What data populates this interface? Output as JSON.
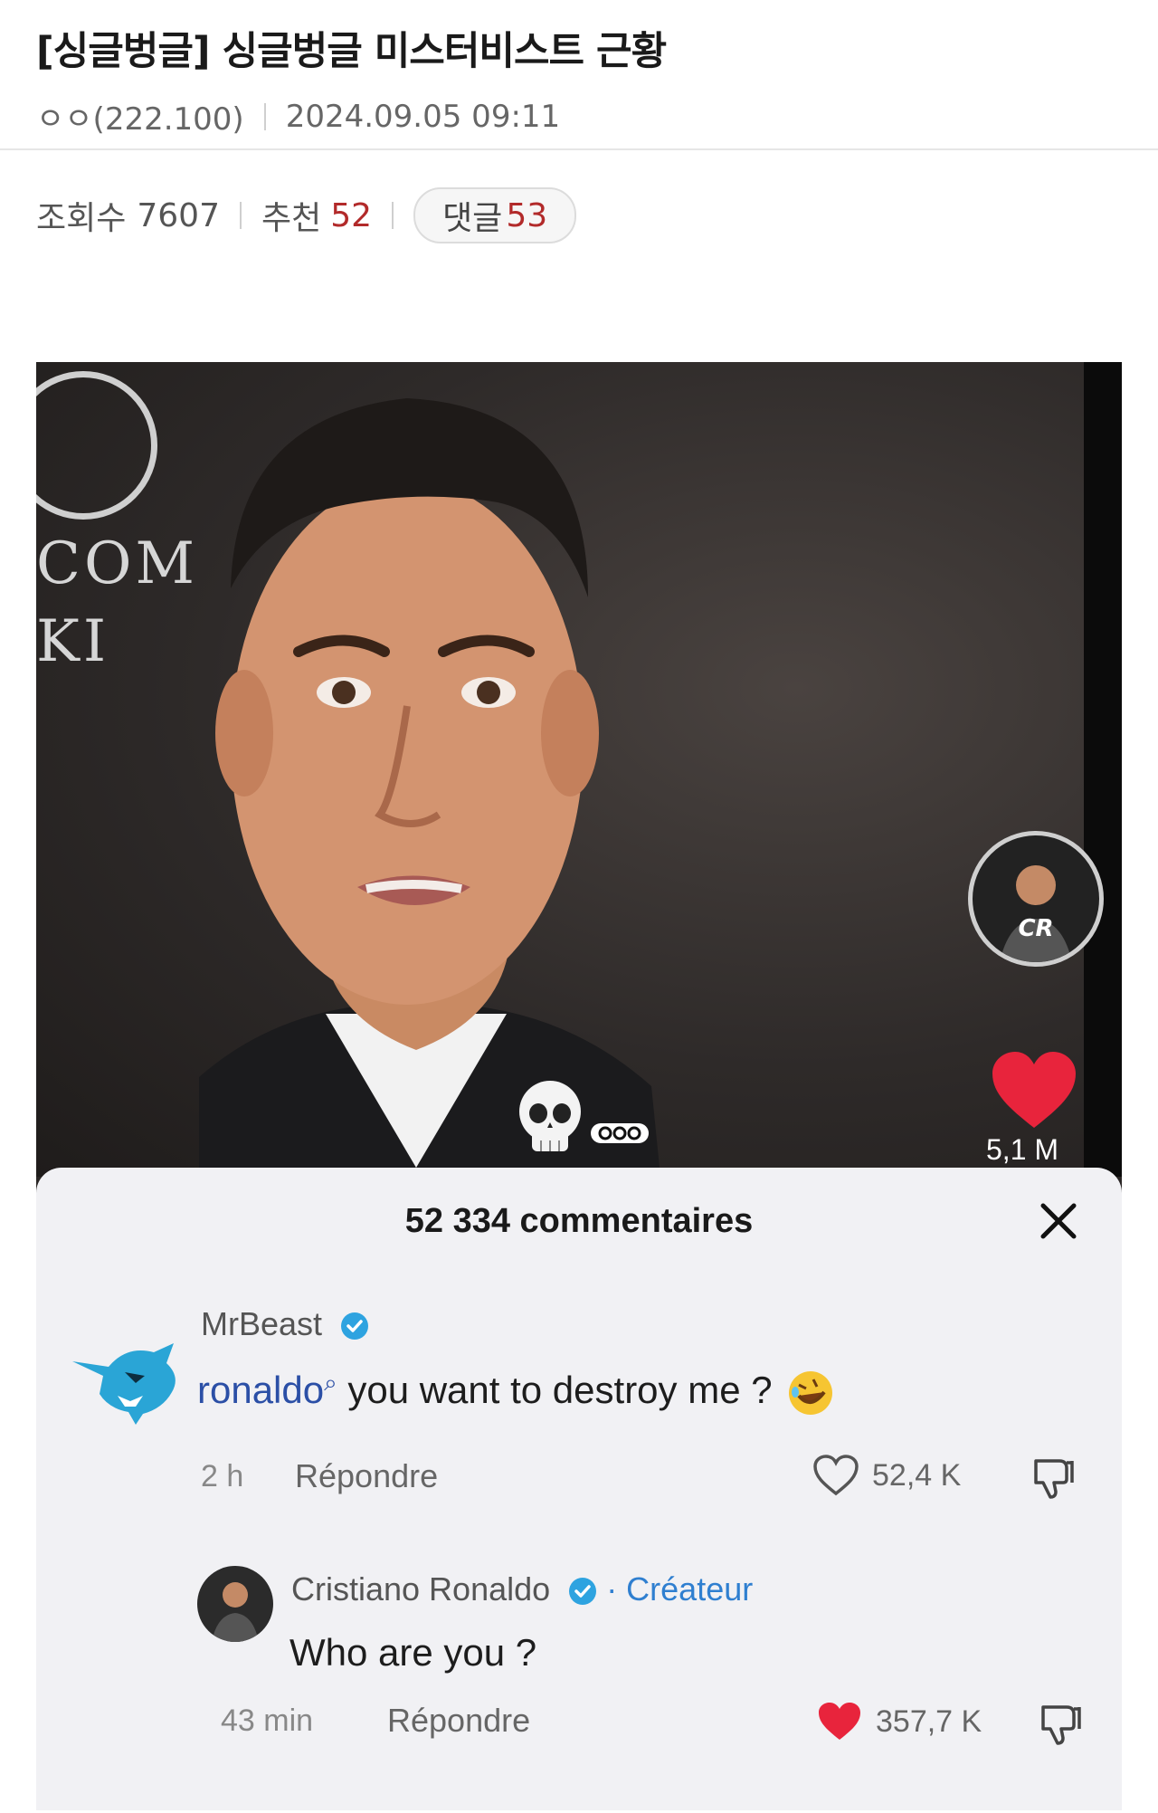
{
  "post": {
    "title": "[싱글벙글] 싱글벙글 미스터비스트 근황",
    "author": "ㅇㅇ(222.100)",
    "datetime": "2024.09.05 09:11",
    "views_label": "조회수",
    "views": "7607",
    "recommend_label": "추천",
    "recommend": "52",
    "comments_label": "댓글",
    "comments": "53"
  },
  "image": {
    "logo_lines": [
      "COM",
      "KI"
    ],
    "avatar_text": "CR",
    "likes": "5,1 M",
    "sheet": {
      "title": "52 334 commentaires",
      "comments": [
        {
          "name": "MrBeast",
          "mention": "ronaldo",
          "text": " you want to destroy me ?",
          "time": "2 h",
          "reply": "Répondre",
          "likes": "52,4 K"
        },
        {
          "name": "Cristiano Ronaldo",
          "tag": "· Créateur",
          "text": "Who are you ?",
          "time": "43 min",
          "reply": "Répondre",
          "likes": "357,7 K"
        }
      ]
    }
  },
  "colors": {
    "accent_red": "#b22a2a",
    "verified_blue": "#2ea3e0",
    "heart_red": "#e8243c",
    "creator_blue": "#2f7fd0"
  }
}
